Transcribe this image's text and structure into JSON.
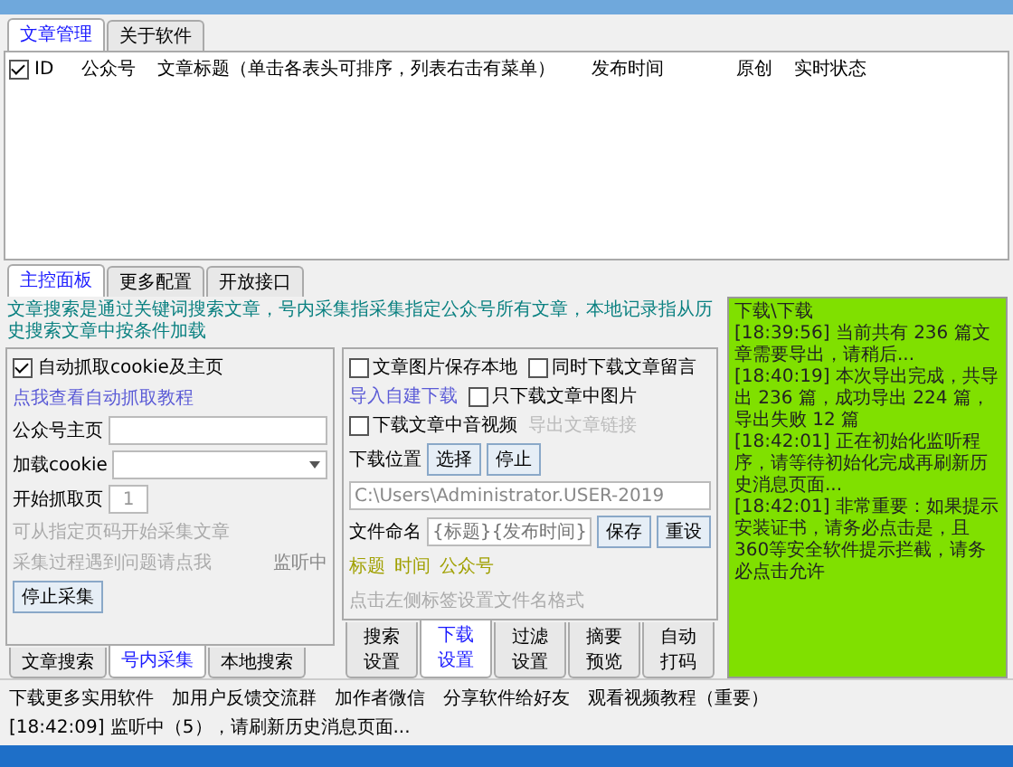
{
  "tabs": [
    {
      "label": "文章管理",
      "selected": true
    },
    {
      "label": "关于软件",
      "selected": false
    }
  ],
  "table": {
    "select_all_checked": true,
    "columns": [
      "ID",
      "公众号",
      "文章标题（单击各表头可排序，列表右击有菜单）",
      "发布时间",
      "原创",
      "实时状态"
    ]
  },
  "control_tabs": [
    {
      "label": "主控面板",
      "selected": true
    },
    {
      "label": "更多配置",
      "selected": false
    },
    {
      "label": "开放接口",
      "selected": false
    }
  ],
  "description": "文章搜索是通过关键词搜索文章，号内采集指采集指定公众号所有文章，本地记录指从历史搜索文章中按条件加载",
  "collect_panel": {
    "auto_cookie": {
      "label": "自动抓取cookie及主页",
      "checked": true
    },
    "tutorial_link": "点我查看自动抓取教程",
    "homepage_label": "公众号主页",
    "cookie_label": "加载cookie",
    "start_page_label": "开始抓取页",
    "start_page_value": "1",
    "start_page_hint": "可从指定页码开始采集文章",
    "problem_link": "采集过程遇到问题请点我",
    "listening": "监听中",
    "stop_button": "停止采集",
    "tabs": [
      {
        "label": "文章搜索",
        "selected": false
      },
      {
        "label": "号内采集",
        "selected": true
      },
      {
        "label": "本地搜索",
        "selected": false
      }
    ]
  },
  "download_panel": {
    "options": [
      {
        "label": "文章图片保存本地",
        "checked": false
      },
      {
        "label": "同时下载文章留言",
        "checked": false
      },
      {
        "label": "只下载文章中图片",
        "checked": false
      },
      {
        "label": "下载文章中音视频",
        "checked": false
      }
    ],
    "import_link": {
      "label": "导入自建下载",
      "disabled": false
    },
    "export_link": {
      "label": "导出文章链接",
      "disabled": true
    },
    "location_label": "下载位置",
    "location_value": "C:\\Users\\Administrator.USER-2019",
    "choose_button": "选择",
    "stop_button": "停止",
    "filename_label": "文件命名",
    "filename_placeholder": "{标题}{发布时间}",
    "save_button": "保存",
    "reset_button": "重设",
    "name_tags": [
      "标题",
      "时间",
      "公众号"
    ],
    "name_hint": "点击左侧标签设置文件名格式",
    "tabs": [
      {
        "label": "搜索设置",
        "selected": false
      },
      {
        "label": "下载设置",
        "selected": true
      },
      {
        "label": "过滤设置",
        "selected": false
      },
      {
        "label": "摘要预览",
        "selected": false
      },
      {
        "label": "自动打码",
        "selected": false
      }
    ]
  },
  "log": {
    "title": "下载\\下载",
    "entries": [
      "[18:39:56] 当前共有 236 篇文章需要导出，请稍后...",
      "[18:40:19] 本次导出完成，共导出 236 篇，成功导出 224 篇，导出失败 12 篇",
      "[18:42:01] 正在初始化监听程序，请等待初始化完成再刷新历史消息页面...",
      "[18:42:01] 非常重要：如果提示安装证书，请务必点击是，且360等安全软件提示拦截，请务必点击允许"
    ]
  },
  "status_bar": [
    "下载更多实用软件",
    "加用户反馈交流群",
    "加作者微信",
    "分享软件给好友",
    "观看视频教程（重要）",
    "[18:42:09] 监听中（5），请刷新历史消息页面..."
  ]
}
